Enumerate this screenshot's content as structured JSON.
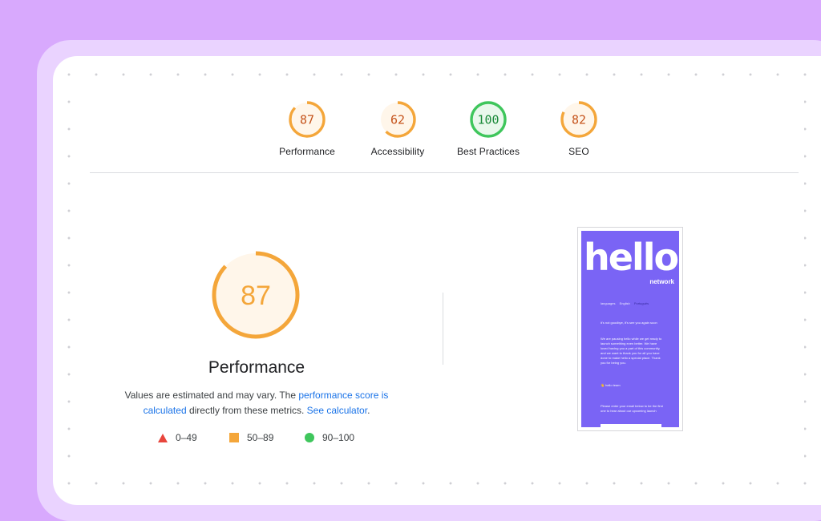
{
  "scores": [
    {
      "name": "Performance",
      "value": "87",
      "fraction": 0.87,
      "color": "#f4a63a",
      "text_color": "#c5531b",
      "bg": "#fff6ea"
    },
    {
      "name": "Accessibility",
      "value": "62",
      "fraction": 0.62,
      "color": "#f4a63a",
      "text_color": "#c5531b",
      "bg": "#fff6ea"
    },
    {
      "name": "Best Practices",
      "value": "100",
      "fraction": 1.0,
      "color": "#3fc65c",
      "text_color": "#1b8a3a",
      "bg": "#e9f8ec"
    },
    {
      "name": "SEO",
      "value": "82",
      "fraction": 0.82,
      "color": "#f4a63a",
      "text_color": "#c5531b",
      "bg": "#fff6ea"
    }
  ],
  "main": {
    "score": "87",
    "fraction": 0.87,
    "title": "Performance",
    "desc_part1": "Values are estimated and may vary. The ",
    "link1": "performance score is calculated",
    "desc_part2": " directly from these metrics. ",
    "link2": "See calculator",
    "desc_part3": "."
  },
  "legend": [
    {
      "range": "0–49",
      "shape": "triangle-icon",
      "color": "#e8453c"
    },
    {
      "range": "50–89",
      "shape": "square-icon",
      "color": "#f4a63a"
    },
    {
      "range": "90–100",
      "shape": "circle-icon",
      "color": "#3fc65c"
    }
  ],
  "thumbnail": {
    "logo": "hello",
    "subtitle": "network",
    "languages_label": "languages",
    "lang1": "English",
    "lang2": "Português",
    "p1": "it's not goodbye, it's see you again soon",
    "p2": "We are pausing hello while we get ready to launch something even better. We have loved having you a part of this community, and we want to thank you for all you have done to make hello a special place. Thank you for being you.",
    "p3": "👋 hello team",
    "p4": "Please enter your email below to be the first one to hear about our upcoming launch"
  }
}
